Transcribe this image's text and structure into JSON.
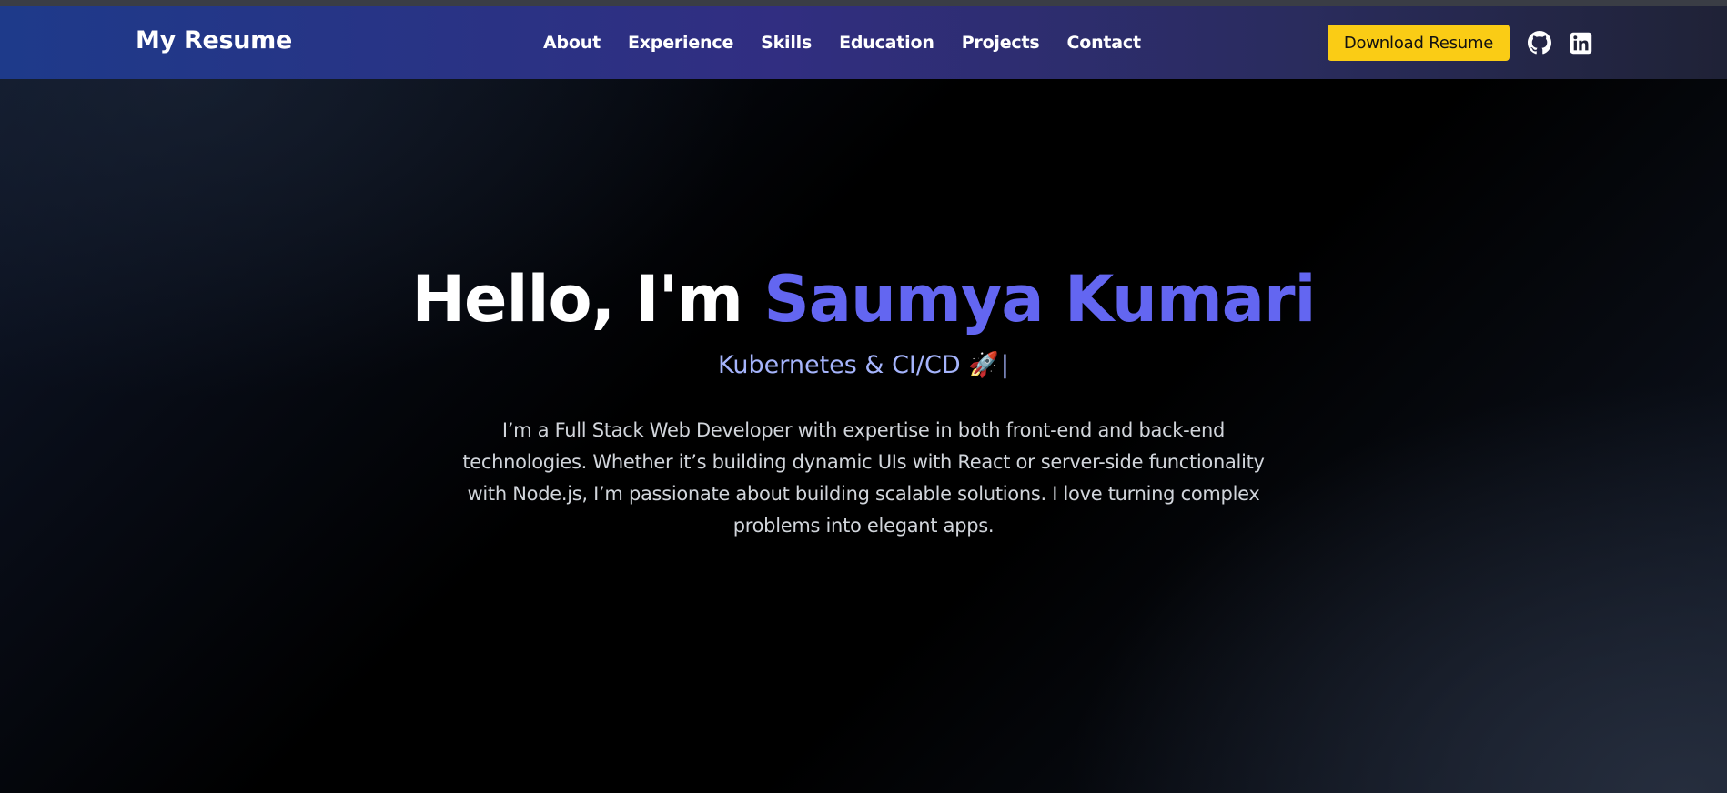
{
  "navbar": {
    "brand": "My Resume",
    "links": [
      "About",
      "Experience",
      "Skills",
      "Education",
      "Projects",
      "Contact"
    ],
    "download_label": "Download Resume",
    "icons": [
      "github-icon",
      "linkedin-icon"
    ]
  },
  "hero": {
    "greeting": "Hello, I'm ",
    "name": "Saumya Kumari",
    "subtitle": "Kubernetes & CI/CD",
    "subtitle_emoji": "🚀",
    "cursor": "|",
    "bio": "I’m a Full Stack Web Developer with expertise in both front-end and back-end technologies. Whether it’s building dynamic UIs with React or server-side functionality with Node.js, I’m passionate about building scalable solutions. I love turning complex problems into elegant apps."
  },
  "colors": {
    "accent": "#6366f1",
    "subtitle": "#a5b4fc",
    "button": "#facc15",
    "nav_start": "#1e3a8a",
    "nav_end": "#1f2236"
  }
}
